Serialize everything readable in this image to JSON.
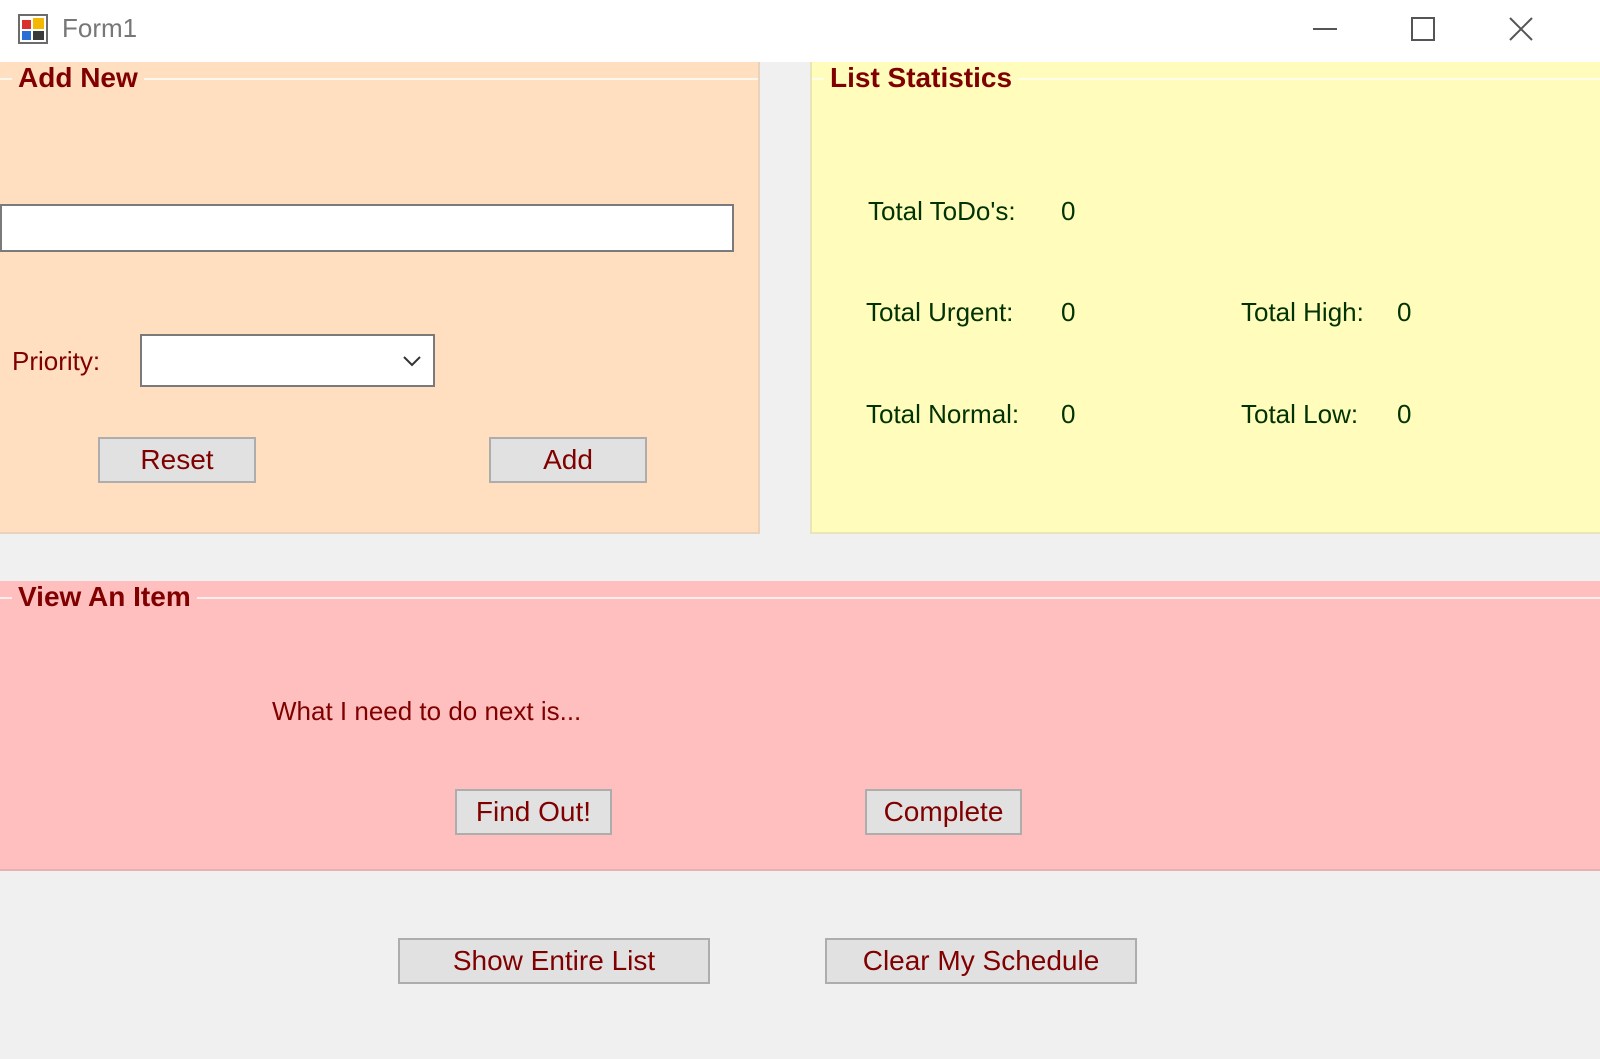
{
  "window": {
    "title": "Form1",
    "icons": {
      "app": "app-form-icon",
      "minimize": "minimize-icon",
      "maximize": "maximize-icon",
      "close": "close-icon"
    }
  },
  "add_new": {
    "title": "Add New",
    "item_input": {
      "value": "",
      "placeholder": ""
    },
    "priority_label": "Priority:",
    "priority_select": {
      "selected": ""
    },
    "reset_label": "Reset",
    "add_label": "Add"
  },
  "stats": {
    "title": "List Statistics",
    "total_todos_label": "Total ToDo's:",
    "total_todos_value": "0",
    "total_urgent_label": "Total Urgent:",
    "total_urgent_value": "0",
    "total_high_label": "Total High:",
    "total_high_value": "0",
    "total_normal_label": "Total Normal:",
    "total_normal_value": "0",
    "total_low_label": "Total Low:",
    "total_low_value": "0"
  },
  "view_item": {
    "title": "View An Item",
    "next_text": "What I need to do next is...",
    "find_out_label": "Find Out!",
    "complete_label": "Complete"
  },
  "footer": {
    "show_list_label": "Show Entire List",
    "clear_schedule_label": "Clear My Schedule"
  },
  "colors": {
    "add_new_bg": "#ffdfc0",
    "stats_bg": "#fffcbc",
    "view_bg": "#ffbfbf",
    "label_text": "#800000",
    "stats_text": "#003300"
  }
}
